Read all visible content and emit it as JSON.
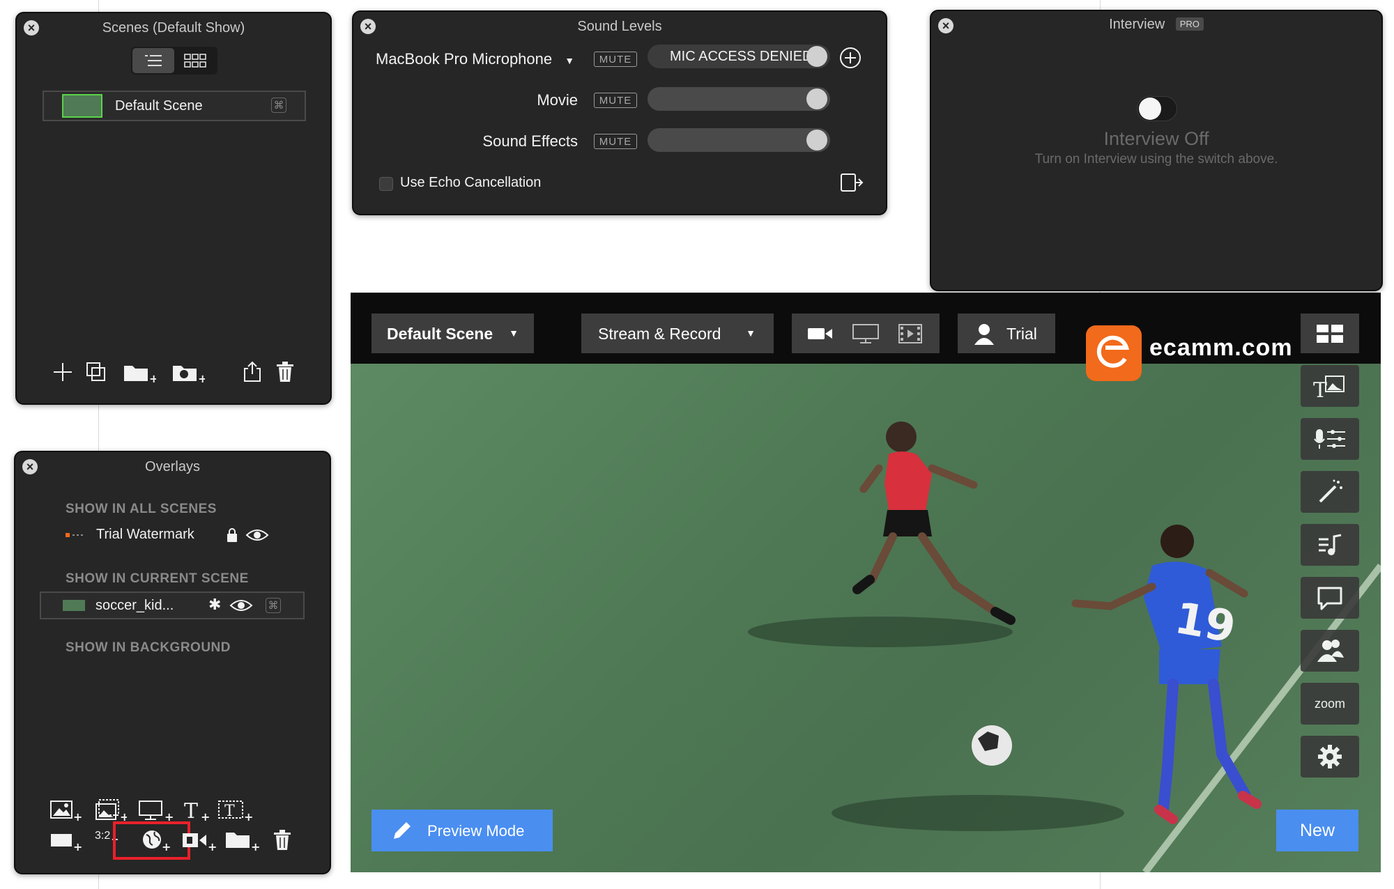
{
  "scenes_panel": {
    "title": "Scenes (Default Show)",
    "view_modes": [
      "list-view",
      "grid-view"
    ],
    "items": [
      {
        "label": "Default Scene",
        "shortcut": "⌘"
      }
    ],
    "toolbar": [
      "add",
      "duplicate",
      "new-folder",
      "new-from-clock",
      "share",
      "delete"
    ]
  },
  "sound_panel": {
    "title": "Sound Levels",
    "source_select": "MacBook Pro Microphone",
    "mute_label": "MUTE",
    "mic_status": "MIC ACCESS DENIED",
    "rows": [
      {
        "label": "Movie"
      },
      {
        "label": "Sound Effects"
      }
    ],
    "echo_label": "Use Echo Cancellation",
    "echo_checked": false
  },
  "interview_panel": {
    "title": "Interview",
    "badge": "PRO",
    "toggle_on": false,
    "status_title": "Interview Off",
    "status_sub": "Turn on Interview using the switch above."
  },
  "overlays_panel": {
    "title": "Overlays",
    "section_all": "SHOW IN ALL SCENES",
    "all_items": [
      {
        "label": "Trial Watermark"
      }
    ],
    "section_current": "SHOW IN CURRENT SCENE",
    "current_items": [
      {
        "label": "soccer_kid...",
        "shortcut": "⌘"
      }
    ],
    "section_background": "SHOW IN BACKGROUND",
    "ratio_label": "3:2"
  },
  "main": {
    "scene_select": "Default Scene",
    "output_select": "Stream & Record",
    "trial_label": "Trial",
    "brand_text": "ecamm.com",
    "zoom_label": "zoom",
    "preview_button": "Preview Mode",
    "new_button": "New",
    "colors": {
      "accent_blue": "#4a8ef0",
      "brand_orange": "#f26a1b",
      "grass": "#4f7a55"
    }
  }
}
